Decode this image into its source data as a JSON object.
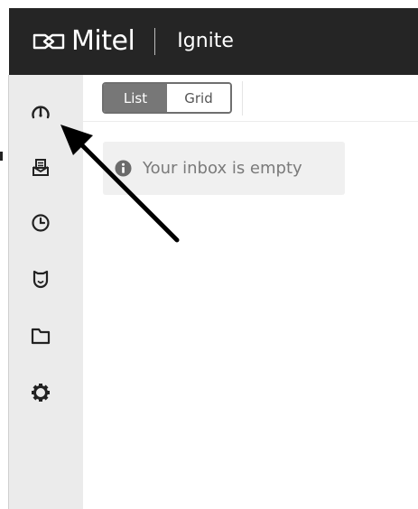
{
  "header": {
    "brand": "Mitel",
    "product": "Ignite"
  },
  "sidebar": {
    "items": [
      {
        "icon": "dashboard-icon"
      },
      {
        "icon": "inbox-icon"
      },
      {
        "icon": "history-icon"
      },
      {
        "icon": "badge-icon"
      },
      {
        "icon": "folder-icon"
      },
      {
        "icon": "gear-icon"
      }
    ]
  },
  "view_toggle": {
    "list_label": "List",
    "grid_label": "Grid",
    "selected": "List"
  },
  "inbox": {
    "empty_message": "Your inbox is empty"
  },
  "colors": {
    "header_bg": "#252525",
    "sidebar_bg": "#ebebeb",
    "toggle_active": "#777777",
    "empty_bg": "#f0f0f0",
    "arrow": "#000000"
  }
}
